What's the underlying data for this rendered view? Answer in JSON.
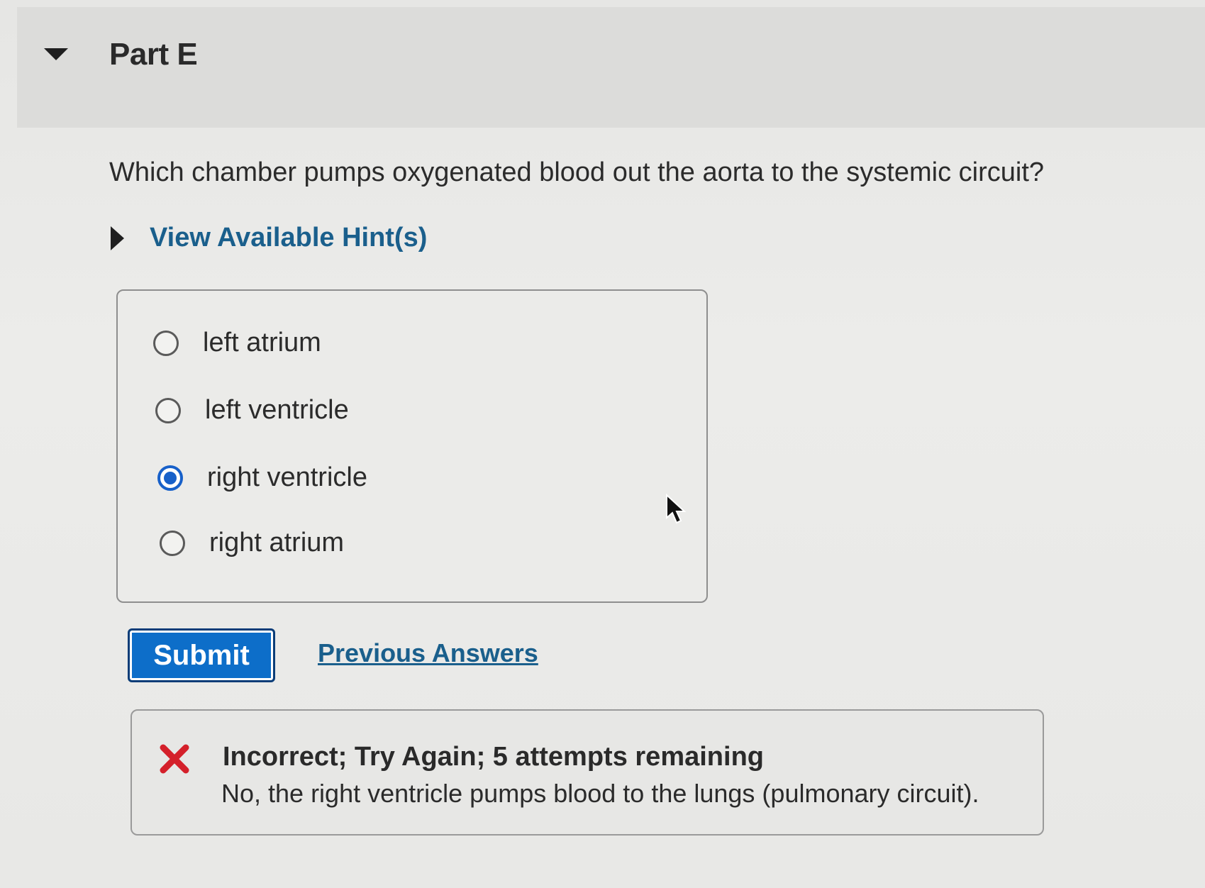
{
  "part": {
    "title": "Part E"
  },
  "question": {
    "text": "Which chamber pumps oxygenated blood out the aorta to the systemic circuit?"
  },
  "hints": {
    "label": "View Available Hint(s)"
  },
  "options": [
    {
      "label": "left atrium",
      "selected": false
    },
    {
      "label": "left ventricle",
      "selected": false
    },
    {
      "label": "right ventricle",
      "selected": true
    },
    {
      "label": "right atrium",
      "selected": false
    }
  ],
  "actions": {
    "submit_label": "Submit",
    "previous_answers_label": "Previous Answers"
  },
  "feedback": {
    "title": "Incorrect; Try Again; 5 attempts remaining",
    "message": "No, the right ventricle pumps blood to the lungs (pulmonary circuit).",
    "icon": "x-mark-icon"
  },
  "colors": {
    "accent_blue": "#0d6ec9",
    "link_blue": "#1a5f8c",
    "error_red": "#d4202a",
    "radio_selected": "#1760c9"
  }
}
